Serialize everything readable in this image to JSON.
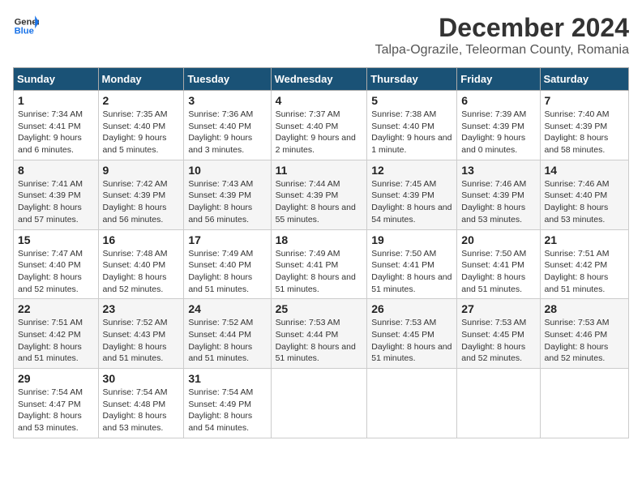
{
  "logo": {
    "line1": "General",
    "line2": "Blue"
  },
  "header": {
    "month": "December 2024",
    "location": "Talpa-Ograzile, Teleorman County, Romania"
  },
  "weekdays": [
    "Sunday",
    "Monday",
    "Tuesday",
    "Wednesday",
    "Thursday",
    "Friday",
    "Saturday"
  ],
  "weeks": [
    [
      {
        "day": "1",
        "sunrise": "Sunrise: 7:34 AM",
        "sunset": "Sunset: 4:41 PM",
        "daylight": "Daylight: 9 hours and 6 minutes."
      },
      {
        "day": "2",
        "sunrise": "Sunrise: 7:35 AM",
        "sunset": "Sunset: 4:40 PM",
        "daylight": "Daylight: 9 hours and 5 minutes."
      },
      {
        "day": "3",
        "sunrise": "Sunrise: 7:36 AM",
        "sunset": "Sunset: 4:40 PM",
        "daylight": "Daylight: 9 hours and 3 minutes."
      },
      {
        "day": "4",
        "sunrise": "Sunrise: 7:37 AM",
        "sunset": "Sunset: 4:40 PM",
        "daylight": "Daylight: 9 hours and 2 minutes."
      },
      {
        "day": "5",
        "sunrise": "Sunrise: 7:38 AM",
        "sunset": "Sunset: 4:40 PM",
        "daylight": "Daylight: 9 hours and 1 minute."
      },
      {
        "day": "6",
        "sunrise": "Sunrise: 7:39 AM",
        "sunset": "Sunset: 4:39 PM",
        "daylight": "Daylight: 9 hours and 0 minutes."
      },
      {
        "day": "7",
        "sunrise": "Sunrise: 7:40 AM",
        "sunset": "Sunset: 4:39 PM",
        "daylight": "Daylight: 8 hours and 58 minutes."
      }
    ],
    [
      {
        "day": "8",
        "sunrise": "Sunrise: 7:41 AM",
        "sunset": "Sunset: 4:39 PM",
        "daylight": "Daylight: 8 hours and 57 minutes."
      },
      {
        "day": "9",
        "sunrise": "Sunrise: 7:42 AM",
        "sunset": "Sunset: 4:39 PM",
        "daylight": "Daylight: 8 hours and 56 minutes."
      },
      {
        "day": "10",
        "sunrise": "Sunrise: 7:43 AM",
        "sunset": "Sunset: 4:39 PM",
        "daylight": "Daylight: 8 hours and 56 minutes."
      },
      {
        "day": "11",
        "sunrise": "Sunrise: 7:44 AM",
        "sunset": "Sunset: 4:39 PM",
        "daylight": "Daylight: 8 hours and 55 minutes."
      },
      {
        "day": "12",
        "sunrise": "Sunrise: 7:45 AM",
        "sunset": "Sunset: 4:39 PM",
        "daylight": "Daylight: 8 hours and 54 minutes."
      },
      {
        "day": "13",
        "sunrise": "Sunrise: 7:46 AM",
        "sunset": "Sunset: 4:39 PM",
        "daylight": "Daylight: 8 hours and 53 minutes."
      },
      {
        "day": "14",
        "sunrise": "Sunrise: 7:46 AM",
        "sunset": "Sunset: 4:40 PM",
        "daylight": "Daylight: 8 hours and 53 minutes."
      }
    ],
    [
      {
        "day": "15",
        "sunrise": "Sunrise: 7:47 AM",
        "sunset": "Sunset: 4:40 PM",
        "daylight": "Daylight: 8 hours and 52 minutes."
      },
      {
        "day": "16",
        "sunrise": "Sunrise: 7:48 AM",
        "sunset": "Sunset: 4:40 PM",
        "daylight": "Daylight: 8 hours and 52 minutes."
      },
      {
        "day": "17",
        "sunrise": "Sunrise: 7:49 AM",
        "sunset": "Sunset: 4:40 PM",
        "daylight": "Daylight: 8 hours and 51 minutes."
      },
      {
        "day": "18",
        "sunrise": "Sunrise: 7:49 AM",
        "sunset": "Sunset: 4:41 PM",
        "daylight": "Daylight: 8 hours and 51 minutes."
      },
      {
        "day": "19",
        "sunrise": "Sunrise: 7:50 AM",
        "sunset": "Sunset: 4:41 PM",
        "daylight": "Daylight: 8 hours and 51 minutes."
      },
      {
        "day": "20",
        "sunrise": "Sunrise: 7:50 AM",
        "sunset": "Sunset: 4:41 PM",
        "daylight": "Daylight: 8 hours and 51 minutes."
      },
      {
        "day": "21",
        "sunrise": "Sunrise: 7:51 AM",
        "sunset": "Sunset: 4:42 PM",
        "daylight": "Daylight: 8 hours and 51 minutes."
      }
    ],
    [
      {
        "day": "22",
        "sunrise": "Sunrise: 7:51 AM",
        "sunset": "Sunset: 4:42 PM",
        "daylight": "Daylight: 8 hours and 51 minutes."
      },
      {
        "day": "23",
        "sunrise": "Sunrise: 7:52 AM",
        "sunset": "Sunset: 4:43 PM",
        "daylight": "Daylight: 8 hours and 51 minutes."
      },
      {
        "day": "24",
        "sunrise": "Sunrise: 7:52 AM",
        "sunset": "Sunset: 4:44 PM",
        "daylight": "Daylight: 8 hours and 51 minutes."
      },
      {
        "day": "25",
        "sunrise": "Sunrise: 7:53 AM",
        "sunset": "Sunset: 4:44 PM",
        "daylight": "Daylight: 8 hours and 51 minutes."
      },
      {
        "day": "26",
        "sunrise": "Sunrise: 7:53 AM",
        "sunset": "Sunset: 4:45 PM",
        "daylight": "Daylight: 8 hours and 51 minutes."
      },
      {
        "day": "27",
        "sunrise": "Sunrise: 7:53 AM",
        "sunset": "Sunset: 4:45 PM",
        "daylight": "Daylight: 8 hours and 52 minutes."
      },
      {
        "day": "28",
        "sunrise": "Sunrise: 7:53 AM",
        "sunset": "Sunset: 4:46 PM",
        "daylight": "Daylight: 8 hours and 52 minutes."
      }
    ],
    [
      {
        "day": "29",
        "sunrise": "Sunrise: 7:54 AM",
        "sunset": "Sunset: 4:47 PM",
        "daylight": "Daylight: 8 hours and 53 minutes."
      },
      {
        "day": "30",
        "sunrise": "Sunrise: 7:54 AM",
        "sunset": "Sunset: 4:48 PM",
        "daylight": "Daylight: 8 hours and 53 minutes."
      },
      {
        "day": "31",
        "sunrise": "Sunrise: 7:54 AM",
        "sunset": "Sunset: 4:49 PM",
        "daylight": "Daylight: 8 hours and 54 minutes."
      },
      null,
      null,
      null,
      null
    ]
  ]
}
